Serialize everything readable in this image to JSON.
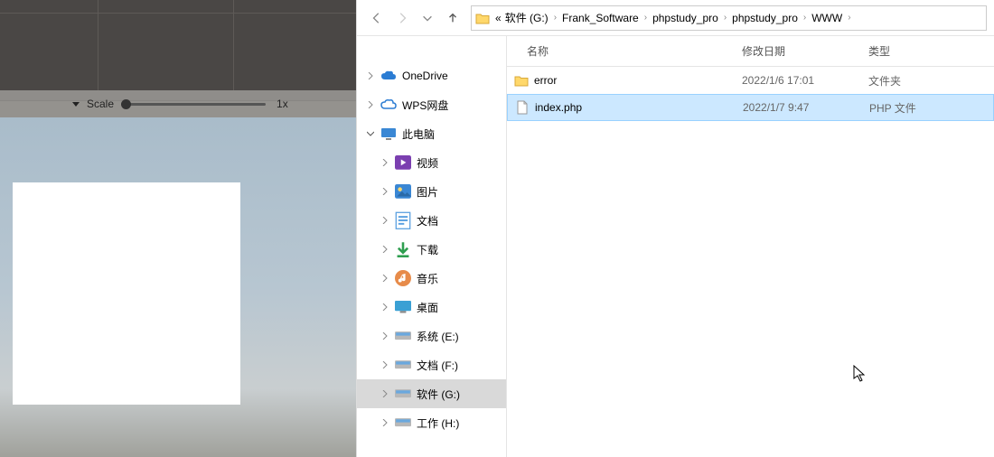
{
  "left": {
    "scale_label": "Scale",
    "scale_value": "1x"
  },
  "breadcrumb": {
    "prefix": "«",
    "items": [
      "软件 (G:)",
      "Frank_Software",
      "phpstudy_pro",
      "phpstudy_pro",
      "WWW"
    ]
  },
  "tree": {
    "items": [
      {
        "label": "OneDrive",
        "expandable": true,
        "indent": false,
        "icon": "cloud-blue"
      },
      {
        "label": "WPS网盘",
        "expandable": true,
        "indent": false,
        "icon": "cloud-outline"
      },
      {
        "label": "此电脑",
        "expandable": true,
        "expanded": true,
        "indent": false,
        "icon": "pc"
      },
      {
        "label": "视频",
        "expandable": true,
        "indent": true,
        "icon": "video"
      },
      {
        "label": "图片",
        "expandable": true,
        "indent": true,
        "icon": "pictures"
      },
      {
        "label": "文档",
        "expandable": true,
        "indent": true,
        "icon": "documents"
      },
      {
        "label": "下载",
        "expandable": true,
        "indent": true,
        "icon": "downloads"
      },
      {
        "label": "音乐",
        "expandable": true,
        "indent": true,
        "icon": "music"
      },
      {
        "label": "桌面",
        "expandable": true,
        "indent": true,
        "icon": "desktop"
      },
      {
        "label": "系统 (E:)",
        "expandable": true,
        "indent": true,
        "icon": "drive"
      },
      {
        "label": "文档 (F:)",
        "expandable": true,
        "indent": true,
        "icon": "drive"
      },
      {
        "label": "软件 (G:)",
        "expandable": true,
        "indent": true,
        "icon": "drive",
        "selected": true
      },
      {
        "label": "工作 (H:)",
        "expandable": true,
        "indent": true,
        "icon": "drive"
      }
    ]
  },
  "columns": {
    "name": "名称",
    "date": "修改日期",
    "type": "类型"
  },
  "files": [
    {
      "name": "error",
      "date": "2022/1/6 17:01",
      "type": "文件夹",
      "icon": "folder",
      "selected": false
    },
    {
      "name": "index.php",
      "date": "2022/1/7 9:47",
      "type": "PHP 文件",
      "icon": "file",
      "selected": true
    }
  ]
}
